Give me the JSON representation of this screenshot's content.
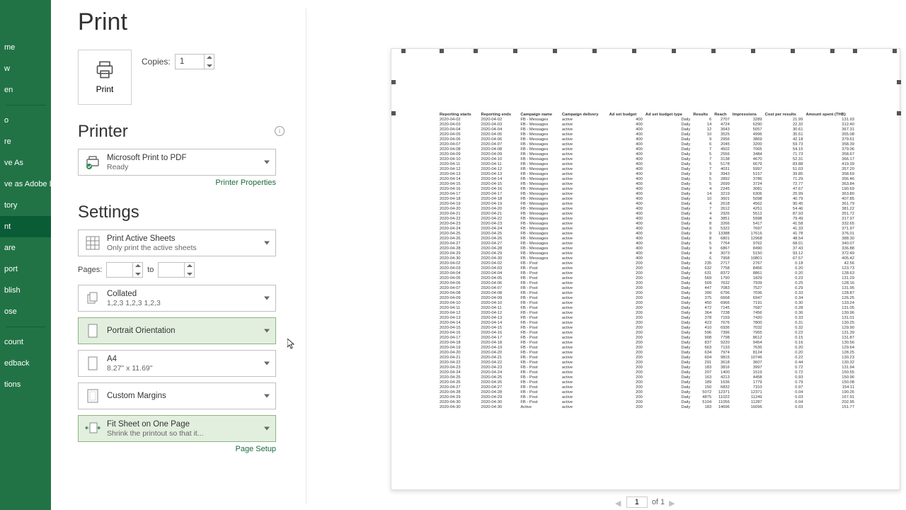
{
  "sidebar": {
    "items": [
      {
        "label": "me"
      },
      {
        "label": "w"
      },
      {
        "label": "en"
      },
      {
        "label": "o"
      },
      {
        "label": "re"
      },
      {
        "label": "ve As"
      },
      {
        "label": "ve as Adobe\nDF"
      },
      {
        "label": "tory"
      },
      {
        "label": "nt"
      },
      {
        "label": "are"
      },
      {
        "label": "port"
      },
      {
        "label": "blish"
      },
      {
        "label": "ose"
      },
      {
        "label": "count"
      },
      {
        "label": "edback"
      },
      {
        "label": "tions"
      }
    ],
    "selected_index": 8
  },
  "title": "Print",
  "copies": {
    "label": "Copies:",
    "value": "1"
  },
  "print_button": "Print",
  "printer": {
    "heading": "Printer",
    "name": "Microsoft Print to PDF",
    "status": "Ready",
    "properties_link": "Printer Properties"
  },
  "settings": {
    "heading": "Settings",
    "print_what": {
      "title": "Print Active Sheets",
      "sub": "Only print the active sheets"
    },
    "pages": {
      "label": "Pages:",
      "to": "to"
    },
    "collate": {
      "title": "Collated",
      "sub": "1,2,3    1,2,3    1,2,3"
    },
    "orientation": {
      "title": "Portrait Orientation"
    },
    "paper": {
      "title": "A4",
      "sub": "8.27\" x 11.69\""
    },
    "margins": {
      "title": "Custom Margins"
    },
    "scaling": {
      "title": "Fit Sheet on One Page",
      "sub": "Shrink the printout so that it..."
    },
    "page_setup_link": "Page Setup"
  },
  "pager": {
    "current": "1",
    "of": "of 1"
  },
  "preview": {
    "headers": [
      "Reporting starts",
      "Reporting ends",
      "Campaign name",
      "Campaign delivery",
      "Ad set budget",
      "Ad set budget type",
      "Results",
      "Reach",
      "Impressions",
      "Cost per results",
      "Amount spent (THB)"
    ],
    "rows": [
      [
        "2020-04-02",
        "2020-04-02",
        "FB - Messages",
        "active",
        "400",
        "Daily",
        "6",
        "2707",
        "3289",
        "21.99",
        "131.93"
      ],
      [
        "2020-04-03",
        "2020-04-03",
        "FB - Messages",
        "active",
        "400",
        "Daily",
        "14",
        "4724",
        "6290",
        "22.32",
        "312.40"
      ],
      [
        "2020-04-04",
        "2020-04-04",
        "FB - Messages",
        "active",
        "400",
        "Daily",
        "12",
        "3643",
        "5057",
        "30.61",
        "367.31"
      ],
      [
        "2020-04-05",
        "2020-04-05",
        "FB - Messages",
        "active",
        "400",
        "Daily",
        "10",
        "3525",
        "4996",
        "35.51",
        "355.08"
      ],
      [
        "2020-04-06",
        "2020-04-06",
        "FB - Messages",
        "active",
        "400",
        "Daily",
        "9",
        "2956",
        "3869",
        "42.18",
        "379.61"
      ],
      [
        "2020-04-07",
        "2020-04-07",
        "FB - Messages",
        "active",
        "400",
        "Daily",
        "6",
        "2045",
        "3200",
        "59.73",
        "358.39"
      ],
      [
        "2020-04-08",
        "2020-04-08",
        "FB - Messages",
        "active",
        "400",
        "Daily",
        "7",
        "4502",
        "7065",
        "54.15",
        "379.06"
      ],
      [
        "2020-04-09",
        "2020-04-09",
        "FB - Messages",
        "active",
        "400",
        "Daily",
        "5",
        "2556",
        "3484",
        "71.73",
        "358.67"
      ],
      [
        "2020-04-10",
        "2020-04-10",
        "FB - Messages",
        "active",
        "400",
        "Daily",
        "7",
        "3138",
        "4670",
        "52.31",
        "366.17"
      ],
      [
        "2020-04-11",
        "2020-04-11",
        "FB - Messages",
        "active",
        "400",
        "Daily",
        "5",
        "5178",
        "6679",
        "83.88",
        "419.39"
      ],
      [
        "2020-04-12",
        "2020-04-12",
        "FB - Messages",
        "active",
        "400",
        "Daily",
        "7",
        "4031",
        "5997",
        "51.03",
        "357.20"
      ],
      [
        "2020-04-13",
        "2020-04-13",
        "FB - Messages",
        "active",
        "400",
        "Daily",
        "9",
        "3943",
        "5157",
        "39.85",
        "358.69"
      ],
      [
        "2020-04-14",
        "2020-04-14",
        "FB - Messages",
        "active",
        "400",
        "Daily",
        "5",
        "2892",
        "3786",
        "71.29",
        "356.46"
      ],
      [
        "2020-04-15",
        "2020-04-15",
        "FB - Messages",
        "active",
        "400",
        "Daily",
        "5",
        "2699",
        "3724",
        "72.77",
        "363.84"
      ],
      [
        "2020-04-16",
        "2020-04-16",
        "FB - Messages",
        "active",
        "400",
        "Daily",
        "4",
        "2245",
        "3081",
        "47.67",
        "190.69"
      ],
      [
        "2020-04-17",
        "2020-04-17",
        "FB - Messages",
        "active",
        "400",
        "Daily",
        "14",
        "3219",
        "6306",
        "25.99",
        "363.80"
      ],
      [
        "2020-04-18",
        "2020-04-18",
        "FB - Messages",
        "active",
        "400",
        "Daily",
        "10",
        "3601",
        "5098",
        "40.79",
        "407.85"
      ],
      [
        "2020-04-19",
        "2020-04-19",
        "FB - Messages",
        "active",
        "400",
        "Daily",
        "4",
        "2618",
        "4562",
        "90.45",
        "361.79"
      ],
      [
        "2020-04-20",
        "2020-04-20",
        "FB - Messages",
        "active",
        "400",
        "Daily",
        "7",
        "2612",
        "4251",
        "54.46",
        "381.22"
      ],
      [
        "2020-04-21",
        "2020-04-21",
        "FB - Messages",
        "active",
        "400",
        "Daily",
        "4",
        "2926",
        "5512",
        "87.93",
        "351.72"
      ],
      [
        "2020-04-22",
        "2020-04-22",
        "FB - Messages",
        "active",
        "400",
        "Daily",
        "4",
        "3851",
        "5998",
        "79.49",
        "317.97"
      ],
      [
        "2020-04-23",
        "2020-04-23",
        "FB - Messages",
        "active",
        "400",
        "Daily",
        "8",
        "3266",
        "5417",
        "41.58",
        "332.65"
      ],
      [
        "2020-04-24",
        "2020-04-24",
        "FB - Messages",
        "active",
        "400",
        "Daily",
        "9",
        "5322",
        "7697",
        "41.33",
        "371.97"
      ],
      [
        "2020-04-25",
        "2020-04-25",
        "FB - Messages",
        "active",
        "400",
        "Daily",
        "9",
        "13388",
        "17616",
        "41.78",
        "376.01"
      ],
      [
        "2020-04-26",
        "2020-04-26",
        "FB - Messages",
        "active",
        "400",
        "Daily",
        "8",
        "6801",
        "12968",
        "48.54",
        "388.30"
      ],
      [
        "2020-04-27",
        "2020-04-27",
        "FB - Messages",
        "active",
        "400",
        "Daily",
        "5",
        "7764",
        "9762",
        "68.01",
        "340.07"
      ],
      [
        "2020-04-28",
        "2020-04-28",
        "FB - Messages",
        "active",
        "400",
        "Daily",
        "9",
        "6867",
        "8490",
        "37.43",
        "336.88"
      ],
      [
        "2020-04-29",
        "2020-04-29",
        "FB - Messages",
        "active",
        "400",
        "Daily",
        "4",
        "3073",
        "5150",
        "93.12",
        "372.49"
      ],
      [
        "2020-04-30",
        "2020-04-30",
        "FB - Messages",
        "active",
        "400",
        "Daily",
        "6",
        "7958",
        "10801",
        "67.57",
        "405.42"
      ],
      [
        "2020-04-02",
        "2020-04-02",
        "FB - Post",
        "active",
        "200",
        "Daily",
        "235",
        "2717",
        "2767",
        "0.18",
        "42.56"
      ],
      [
        "2020-04-03",
        "2020-04-03",
        "FB - Post",
        "active",
        "200",
        "Daily",
        "632",
        "7758",
        "8456",
        "0.20",
        "123.73"
      ],
      [
        "2020-04-04",
        "2020-04-04",
        "FB - Post",
        "active",
        "200",
        "Daily",
        "631",
        "8372",
        "8861",
        "0.20",
        "128.63"
      ],
      [
        "2020-04-05",
        "2020-04-05",
        "FB - Post",
        "active",
        "200",
        "Daily",
        "569",
        "1790",
        "1829",
        "0.23",
        "131.29"
      ],
      [
        "2020-04-06",
        "2020-04-06",
        "FB - Post",
        "active",
        "200",
        "Daily",
        "509",
        "7632",
        "7939",
        "0.25",
        "128.16"
      ],
      [
        "2020-04-07",
        "2020-04-07",
        "FB - Post",
        "active",
        "200",
        "Daily",
        "447",
        "7083",
        "7527",
        "0.29",
        "131.95"
      ],
      [
        "2020-04-08",
        "2020-04-08",
        "FB - Post",
        "active",
        "200",
        "Daily",
        "390",
        "6796",
        "7036",
        "0.33",
        "128.87"
      ],
      [
        "2020-04-09",
        "2020-04-09",
        "FB - Post",
        "active",
        "200",
        "Daily",
        "375",
        "6668",
        "6947",
        "0.34",
        "126.25"
      ],
      [
        "2020-04-10",
        "2020-04-10",
        "FB - Post",
        "active",
        "200",
        "Daily",
        "450",
        "6966",
        "7191",
        "0.30",
        "133.24"
      ],
      [
        "2020-04-11",
        "2020-04-11",
        "FB - Post",
        "active",
        "200",
        "Daily",
        "472",
        "7145",
        "7687",
        "0.28",
        "131.05"
      ],
      [
        "2020-04-12",
        "2020-04-12",
        "FB - Post",
        "active",
        "200",
        "Daily",
        "364",
        "7238",
        "7456",
        "0.36",
        "130.96"
      ],
      [
        "2020-04-13",
        "2020-04-13",
        "FB - Post",
        "active",
        "200",
        "Daily",
        "378",
        "7159",
        "7420",
        "0.33",
        "131.01"
      ],
      [
        "2020-04-14",
        "2020-04-14",
        "FB - Post",
        "active",
        "200",
        "Daily",
        "423",
        "7676",
        "7800",
        "0.31",
        "130.25"
      ],
      [
        "2020-04-15",
        "2020-04-15",
        "FB - Post",
        "active",
        "200",
        "Daily",
        "410",
        "6936",
        "7032",
        "0.32",
        "129.90"
      ],
      [
        "2020-04-16",
        "2020-04-16",
        "FB - Post",
        "active",
        "200",
        "Daily",
        "596",
        "7396",
        "7955",
        "0.22",
        "131.39"
      ],
      [
        "2020-04-17",
        "2020-04-17",
        "FB - Post",
        "active",
        "200",
        "Daily",
        "908",
        "7798",
        "8612",
        "0.15",
        "131.87"
      ],
      [
        "2020-04-18",
        "2020-04-18",
        "FB - Post",
        "active",
        "200",
        "Daily",
        "837",
        "9220",
        "9454",
        "0.16",
        "130.56"
      ],
      [
        "2020-04-19",
        "2020-04-19",
        "FB - Post",
        "active",
        "200",
        "Daily",
        "663",
        "7133",
        "7635",
        "0.20",
        "129.64"
      ],
      [
        "2020-04-20",
        "2020-04-20",
        "FB - Post",
        "active",
        "200",
        "Daily",
        "634",
        "7974",
        "8124",
        "0.20",
        "128.25"
      ],
      [
        "2020-04-21",
        "2020-04-21",
        "FB - Post",
        "active",
        "200",
        "Daily",
        "604",
        "9815",
        "10746",
        "0.22",
        "130.23"
      ],
      [
        "2020-04-22",
        "2020-04-22",
        "FB - Post",
        "active",
        "200",
        "Daily",
        "291",
        "3618",
        "3607",
        "0.44",
        "130.32"
      ],
      [
        "2020-04-23",
        "2020-04-23",
        "FB - Post",
        "active",
        "200",
        "Daily",
        "183",
        "3816",
        "3997",
        "0.72",
        "131.94"
      ],
      [
        "2020-04-24",
        "2020-04-24",
        "FB - Post",
        "active",
        "200",
        "Daily",
        "207",
        "1400",
        "1519",
        "0.72",
        "150.55"
      ],
      [
        "2020-04-25",
        "2020-04-25",
        "FB - Post",
        "active",
        "200",
        "Daily",
        "163",
        "4213",
        "4458",
        "0.93",
        "150.96"
      ],
      [
        "2020-04-26",
        "2020-04-26",
        "FB - Post",
        "active",
        "200",
        "Daily",
        "189",
        "1636",
        "1779",
        "0.79",
        "150.08"
      ],
      [
        "2020-04-27",
        "2020-04-27",
        "FB - Post",
        "active",
        "200",
        "Daily",
        "150",
        "6832",
        "7310",
        "0.97",
        "154.11"
      ],
      [
        "2020-04-28",
        "2020-04-28",
        "FB - Post",
        "active",
        "200",
        "Daily",
        "5072",
        "12371",
        "12371",
        "0.04",
        "190.26"
      ],
      [
        "2020-04-29",
        "2020-04-29",
        "FB - Post",
        "active",
        "200",
        "Daily",
        "4875",
        "11022",
        "11249",
        "0.03",
        "167.91"
      ],
      [
        "2020-04-30",
        "2020-04-30",
        "FB - Post",
        "active",
        "200",
        "Daily",
        "5104",
        "11056",
        "11287",
        "0.04",
        "202.95"
      ],
      [
        "2020-04-30",
        "2020-04-30",
        "Active",
        "active",
        "200",
        "Daily",
        "183",
        "14696",
        "16096",
        "0.03",
        "151.77"
      ]
    ]
  }
}
